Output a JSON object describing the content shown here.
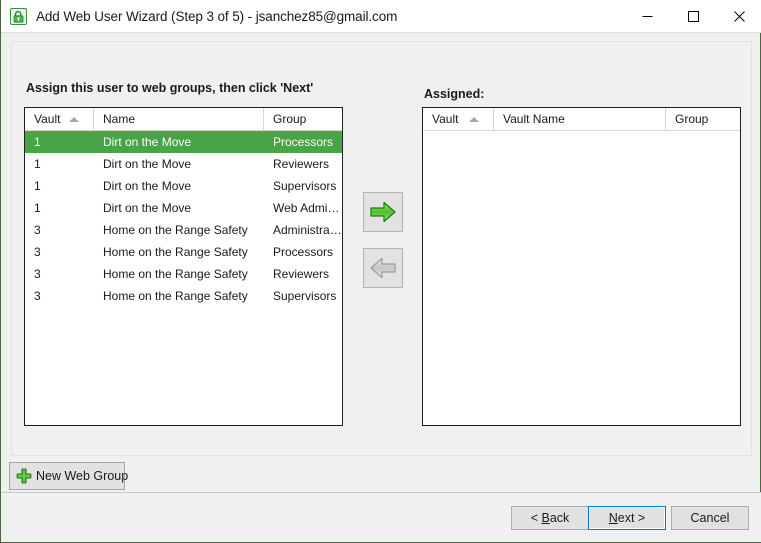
{
  "window": {
    "title": "Add Web User Wizard (Step 3 of 5) - jsanchez85@gmail.com",
    "app_icon": "web-user-lock-icon",
    "controls": {
      "minimize": "minimize-icon",
      "maximize": "maximize-icon",
      "close": "close-icon"
    }
  },
  "left_panel": {
    "heading": "Assign this user to web groups, then click 'Next'",
    "columns": [
      "Vault",
      "Name",
      "Group"
    ],
    "sorted_column": "Vault",
    "sort_direction": "ascending",
    "rows": [
      {
        "vault": "1",
        "name": "Dirt on the Move",
        "group": "Processors",
        "selected": true
      },
      {
        "vault": "1",
        "name": "Dirt on the Move",
        "group": "Reviewers",
        "selected": false
      },
      {
        "vault": "1",
        "name": "Dirt on the Move",
        "group": "Supervisors",
        "selected": false
      },
      {
        "vault": "1",
        "name": "Dirt on the Move",
        "group": "Web Admini…",
        "selected": false
      },
      {
        "vault": "3",
        "name": "Home on the Range Safety",
        "group": "Administrators",
        "selected": false
      },
      {
        "vault": "3",
        "name": "Home on the Range Safety",
        "group": "Processors",
        "selected": false
      },
      {
        "vault": "3",
        "name": "Home on the Range Safety",
        "group": "Reviewers",
        "selected": false
      },
      {
        "vault": "3",
        "name": "Home on the Range Safety",
        "group": "Supervisors",
        "selected": false
      }
    ]
  },
  "right_panel": {
    "heading": "Assigned:",
    "columns": [
      "Vault",
      "Vault Name",
      "Group"
    ],
    "sorted_column": "Vault",
    "sort_direction": "ascending",
    "rows": []
  },
  "transfer": {
    "assign_icon": "arrow-right-icon",
    "assign_enabled": true,
    "unassign_icon": "arrow-left-icon",
    "unassign_enabled": false
  },
  "actions": {
    "new_web_group": "New Web Group",
    "new_web_group_icon": "plus-icon"
  },
  "footer": {
    "back": "< Back",
    "back_accel": "B",
    "next": "Next >",
    "next_accel": "N",
    "cancel": "Cancel",
    "focused": "Next >"
  },
  "colors": {
    "selection_green": "#47a447",
    "accent_blue": "#0078d7",
    "icon_green": "#3faa3f",
    "window_bg": "#f0f0f0",
    "list_bg": "#ffffff"
  }
}
